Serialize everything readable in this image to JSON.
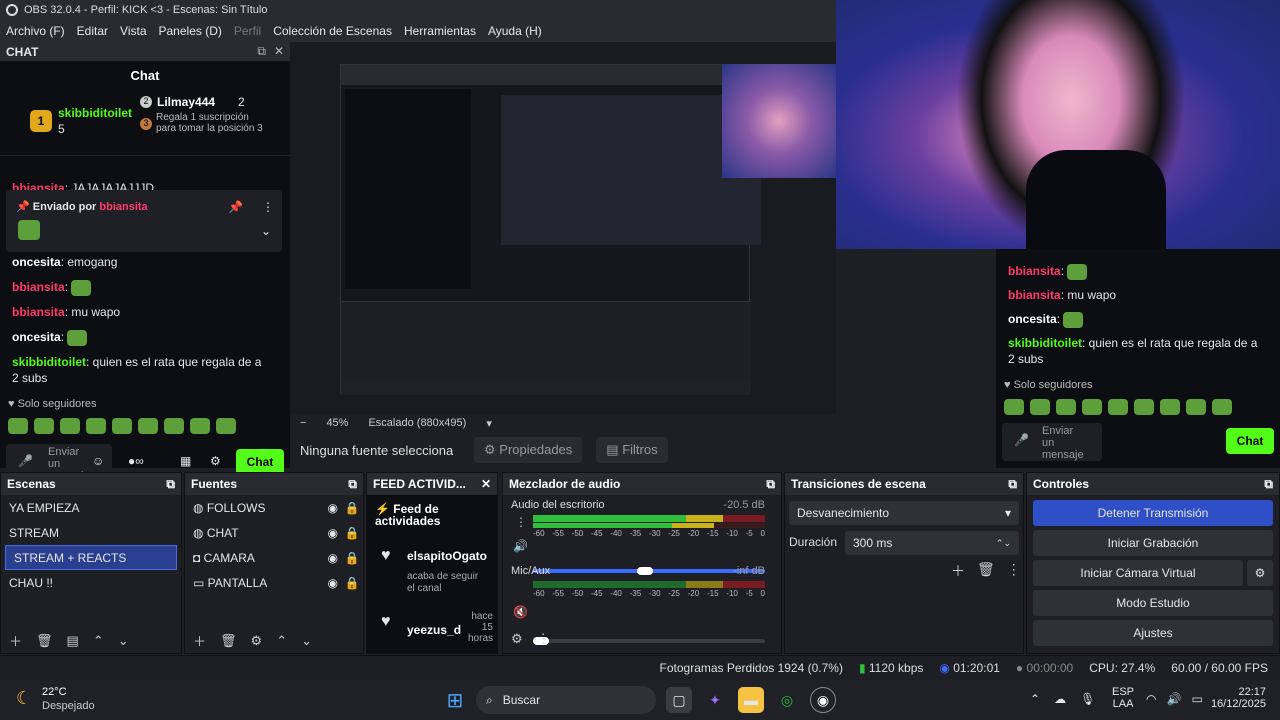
{
  "window": {
    "title": "OBS 32.0.4 - Perfil: KICK <3 - Escenas: Sin Título"
  },
  "menu": [
    "Archivo (F)",
    "Editar",
    "Vista",
    "Paneles (D)",
    "Perfil",
    "Colección de Escenas",
    "Herramientas",
    "Ayuda (H)"
  ],
  "chat": {
    "dock_title": "CHAT",
    "title": "Chat",
    "top1": {
      "rank": "1",
      "user": "skibbiditoilet",
      "count": "5"
    },
    "top2": {
      "rank": "2",
      "user": "Lilmay444",
      "count": "2"
    },
    "top3": {
      "rank": "3",
      "text": "Regala 1 suscripción para tomar la posición 3"
    },
    "cut_message": {
      "user": "bbiansita",
      "text": ": JAJAJAJAJJJD"
    },
    "pinned": {
      "label": "Enviado por",
      "user": "bbiansita"
    },
    "messages": [
      {
        "user": "oncesita",
        "text": ": emogang"
      },
      {
        "user": "bbiansita",
        "text": ":"
      },
      {
        "user": "bbiansita",
        "text": ": mu wapo"
      },
      {
        "user": "oncesita",
        "text": ":"
      },
      {
        "user": "skibbiditoilet",
        "text": ": quien es el rata que regala de a 2 subs"
      }
    ],
    "followers_only": "Solo seguidores",
    "input_placeholder": "Enviar un mensaje",
    "send_label": "Chat"
  },
  "preview": {
    "zoom": "45%",
    "scaling": "Escalado (880x495)",
    "no_source": "Ninguna fuente selecciona",
    "properties": "Propiedades",
    "filters": "Filtros"
  },
  "scenes": {
    "title": "Escenas",
    "items": [
      "YA EMPIEZA",
      "STREAM",
      "STREAM + REACTS",
      "CHAU !!"
    ],
    "selected_index": 2
  },
  "sources": {
    "title": "Fuentes",
    "items": [
      {
        "name": "FOLLOWS",
        "icon": "globe-icon"
      },
      {
        "name": "CHAT",
        "icon": "globe-icon"
      },
      {
        "name": "CAMARA",
        "icon": "camera-icon"
      },
      {
        "name": "PANTALLA",
        "icon": "monitor-icon"
      }
    ]
  },
  "feed": {
    "title": "FEED ACTIVID...",
    "header": "Feed de actividades",
    "items": [
      {
        "user": "elsapitoOgato",
        "text": "acaba de seguir el canal",
        "time": ""
      },
      {
        "user": "yeezus_d",
        "text": "",
        "time": "hace 15 horas"
      }
    ]
  },
  "mixer": {
    "title": "Mezclador de audio",
    "channels": [
      {
        "name": "Audio del escritorio",
        "db": "-20.5 dB",
        "level": 0.82,
        "volume": 0.79
      },
      {
        "name": "Mic/Aux",
        "db": "-inf dB",
        "level": 0.0,
        "volume": 0.05
      }
    ],
    "ticks": [
      "-60",
      "-55",
      "-50",
      "-45",
      "-40",
      "-35",
      "-30",
      "-25",
      "-20",
      "-15",
      "-10",
      "-5",
      "0"
    ]
  },
  "transitions": {
    "title": "Transiciones de escena",
    "selected": "Desvanecimiento",
    "duration_label": "Duración",
    "duration_value": "300 ms"
  },
  "controls": {
    "title": "Controles",
    "buttons": [
      "Detener Transmisión",
      "Iniciar Grabación",
      "Iniciar Cámara Virtual",
      "Modo Estudio",
      "Ajustes"
    ]
  },
  "status": {
    "dropped": "Fotogramas Perdidos 1924 (0.7%)",
    "bitrate": "1120 kbps",
    "live_time": "01:20:01",
    "rec_time": "00:00:00",
    "cpu": "CPU: 27.4%",
    "fps": "60.00 / 60.00 FPS"
  },
  "taskbar": {
    "weather_temp": "22°C",
    "weather_text": "Despejado",
    "search": "Buscar",
    "lang": "ESP",
    "lang2": "LAA",
    "time": "22:17",
    "date": "16/12/2025"
  },
  "colors": {
    "kick_green": "#53fc18",
    "accent_blue": "#2f4fc7",
    "username_pink": "#ff3b6b"
  }
}
